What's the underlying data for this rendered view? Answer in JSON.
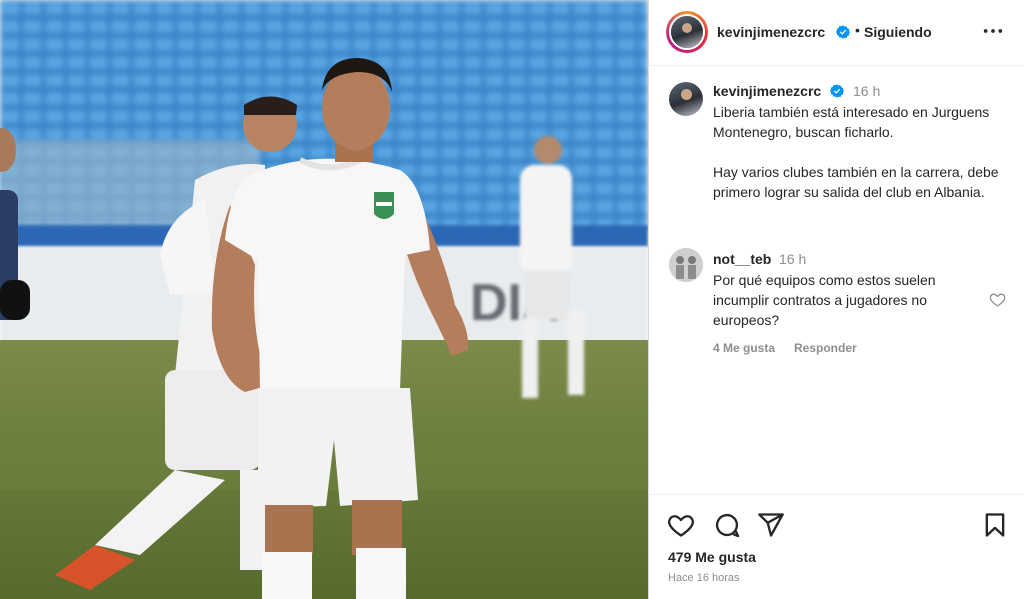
{
  "post": {
    "image_alt": "",
    "banner_text": "DIA"
  },
  "header": {
    "username": "kevinjimenezcrc",
    "separator": "•",
    "follow_label": "Siguiendo"
  },
  "caption": {
    "username": "kevinjimenezcrc",
    "time": "16 h",
    "text": "Liberia también está interesado en Jurguens Montenegro, buscan ficharlo.\n\nHay varios clubes también en la carrera, debe primero lograr su salida del club en Albania."
  },
  "comment": {
    "username": "not__teb",
    "time": "16 h",
    "text": "Por qué equipos como estos suelen incumplir contratos a jugadores no europeos?",
    "likes": "4 Me gusta",
    "reply_label": "Responder"
  },
  "footer": {
    "likes": "479 Me gusta",
    "posted": "Hace 16 horas"
  },
  "icons": {
    "verified": "verified-badge-icon",
    "more": "more-options-icon",
    "like": "heart-icon",
    "comment": "comment-icon",
    "share": "share-icon",
    "save": "bookmark-icon"
  },
  "colors": {
    "verified": "#0095f6",
    "text": "#262626",
    "muted": "#8e8e8e",
    "border": "#dbdbdb"
  }
}
